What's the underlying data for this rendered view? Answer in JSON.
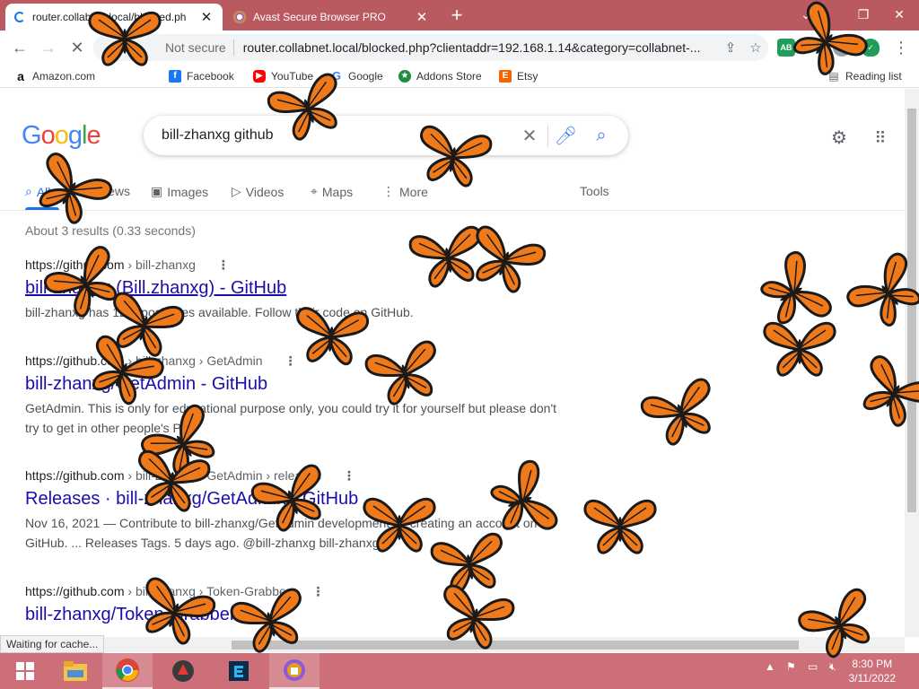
{
  "browser": {
    "tabs": [
      {
        "label": "router.collabnet.local/blocked.ph",
        "active": true
      },
      {
        "label": "Avast Secure Browser PRO",
        "active": false
      }
    ],
    "new_tab": "+",
    "url_security": "Not secure",
    "url": "router.collabnet.local/blocked.php?clientaddr=192.168.1.14&category=collabnet-...",
    "bookmarks": [
      {
        "label": "Amazon.com",
        "icon": "amazon-icon"
      },
      {
        "label": "Facebook",
        "icon": "facebook-icon"
      },
      {
        "label": "YouTube",
        "icon": "youtube-icon"
      },
      {
        "label": "Google",
        "icon": "google-icon"
      },
      {
        "label": "Addons Store",
        "icon": "addons-store-icon"
      },
      {
        "label": "Etsy",
        "icon": "etsy-icon"
      }
    ],
    "reading_list": "Reading list",
    "status": "Waiting for cache..."
  },
  "google": {
    "logo": "Google",
    "query": "bill-zhanxg github",
    "tabs": [
      "All",
      "News",
      "Images",
      "Videos",
      "Maps",
      "More",
      "Tools"
    ],
    "stats": "About 3 results (0.33 seconds)",
    "results": [
      {
        "cite_host": "https://github.com",
        "cite_path": " › bill-zhanxg",
        "title": "bill-zhanxg (Bill.zhanxg) - GitHub",
        "snippet": "bill-zhanxg has 12 repositories available. Follow their code on GitHub."
      },
      {
        "cite_host": "https://github.com",
        "cite_path": " › bill-zhanxg › GetAdmin",
        "title": "bill-zhanxg/GetAdmin - GitHub",
        "snippet": "GetAdmin. This is only for educational purpose only, you could try it for yourself but please don't try to get in other people's PC."
      },
      {
        "cite_host": "https://github.com",
        "cite_path": " › bill-zhanxg › GetAdmin › releases",
        "title": "Releases · bill-zhanxg/GetAdmin · GitHub",
        "snippet": "Nov 16, 2021 — Contribute to bill-zhanxg/GetAdmin development by creating an account on GitHub. ... Releases Tags. 5 days ago. @bill-zhanxg bill-zhanxg."
      },
      {
        "cite_host": "https://github.com",
        "cite_path": " › bill-zhanxg › Token-Grabber",
        "title": "bill-zhanxg/Token-Grabber",
        "snippet": ""
      }
    ]
  },
  "taskbar": {
    "time": "8:30 PM",
    "date": "3/11/2022"
  },
  "colors": {
    "tabbar": "#b85a5f",
    "taskbar": "#cc6f79",
    "link": "#1a0dab",
    "butterfly_wing": "#f07a1a",
    "butterfly_vein": "#1a1a1a"
  }
}
